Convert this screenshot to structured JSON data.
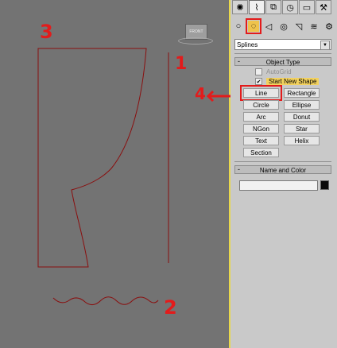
{
  "viewport": {
    "cube_label": "FRONT",
    "annotations": [
      "3",
      "1",
      "2",
      "4"
    ]
  },
  "panel": {
    "tabs": [
      {
        "icon": "sun-icon",
        "glyph": "✺"
      },
      {
        "icon": "curve-icon",
        "glyph": "⌇"
      },
      {
        "icon": "hierarchy-icon",
        "glyph": "⧉"
      },
      {
        "icon": "motion-icon",
        "glyph": "◷"
      },
      {
        "icon": "display-icon",
        "glyph": "▭"
      },
      {
        "icon": "hammer-icon",
        "glyph": "⚒"
      }
    ],
    "subtypes": [
      {
        "icon": "geometry-sphere-icon",
        "glyph": "○"
      },
      {
        "icon": "shapes-icon",
        "glyph": "◌"
      },
      {
        "icon": "lights-icon",
        "glyph": "◁"
      },
      {
        "icon": "cameras-icon",
        "glyph": "◎"
      },
      {
        "icon": "helpers-icon",
        "glyph": "◹"
      },
      {
        "icon": "spacewarps-icon",
        "glyph": "≋"
      },
      {
        "icon": "systems-icon",
        "glyph": "⚙"
      }
    ],
    "dropdown_value": "Splines",
    "object_type": {
      "title": "Object Type",
      "autogrid_label": "AutoGrid",
      "start_new_shape_label": "Start New Shape",
      "start_new_shape_checked": "✔",
      "buttons": [
        "Line",
        "Rectangle",
        "Circle",
        "Ellipse",
        "Arc",
        "Donut",
        "NGon",
        "Star",
        "Text",
        "Helix",
        "Section"
      ]
    },
    "name_color": {
      "title": "Name and Color",
      "name_value": "",
      "color": "#0a0a0a"
    }
  }
}
